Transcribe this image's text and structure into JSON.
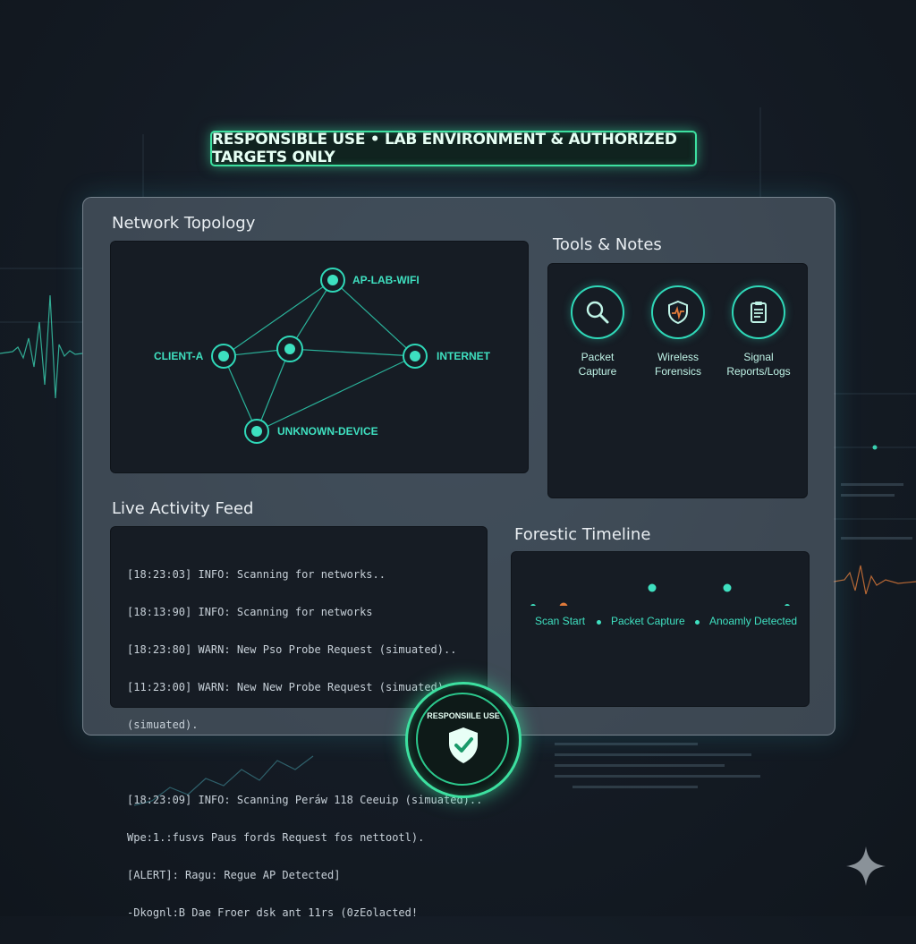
{
  "banner": {
    "text": "RESPONSIBLE USE • LAB ENVIRONMENT & AUTHORIZED TARGETS ONLY"
  },
  "colors": {
    "accent": "#2fd8b8",
    "banner_border": "#3de0a0",
    "panel_bg": "#161c24",
    "warn_marker": "#e07a3a"
  },
  "topology": {
    "title": "Network Topology",
    "nodes": [
      {
        "id": "ap",
        "label": "AP-LAB-WIFI"
      },
      {
        "id": "client",
        "label": "CLIENT-A"
      },
      {
        "id": "hub",
        "label": ""
      },
      {
        "id": "internet",
        "label": "INTERNET"
      },
      {
        "id": "unknown",
        "label": "UNKNOWN-DEVICE"
      }
    ]
  },
  "tools": {
    "title": "Tools & Notes",
    "items": [
      {
        "icon": "magnifier-icon",
        "line1": "Packet",
        "line2": "Capture"
      },
      {
        "icon": "shield-pulse-icon",
        "line1": "Wireless",
        "line2": "Forensics"
      },
      {
        "icon": "clipboard-icon",
        "line1": "Signal",
        "line2": "Reports/Logs"
      }
    ]
  },
  "feed": {
    "title": "Live Activity Feed",
    "lines": [
      "[18:23:03] INFO: Scanning for networks..",
      "[18:13:90] INFO: Scanning for networks",
      "[18:23:80] WARN: New Pso Probe Request (simuated)..",
      "[11:23:00] WARN: New New Probe Request (simuated)",
      "(simuated).",
      "",
      "[18:23:09] INFO: Scanning Peráw 118 Ceeuip (simuated)..",
      "Wpe:1.:fusvs Paus fords Request fos nettootl).",
      "[ALERT]: Ragu: Regue AP Detected]",
      "-Dkognl:B Dae Froer dsk ant 11rs (0zEolacted!"
    ]
  },
  "timeline": {
    "title": "Forestic Timeline",
    "events": [
      "Scan Start",
      "Packet Capture",
      "Anoamly Detected"
    ]
  },
  "badge": {
    "text": "RESPONSIILE USE",
    "icon": "shield-check-icon"
  }
}
